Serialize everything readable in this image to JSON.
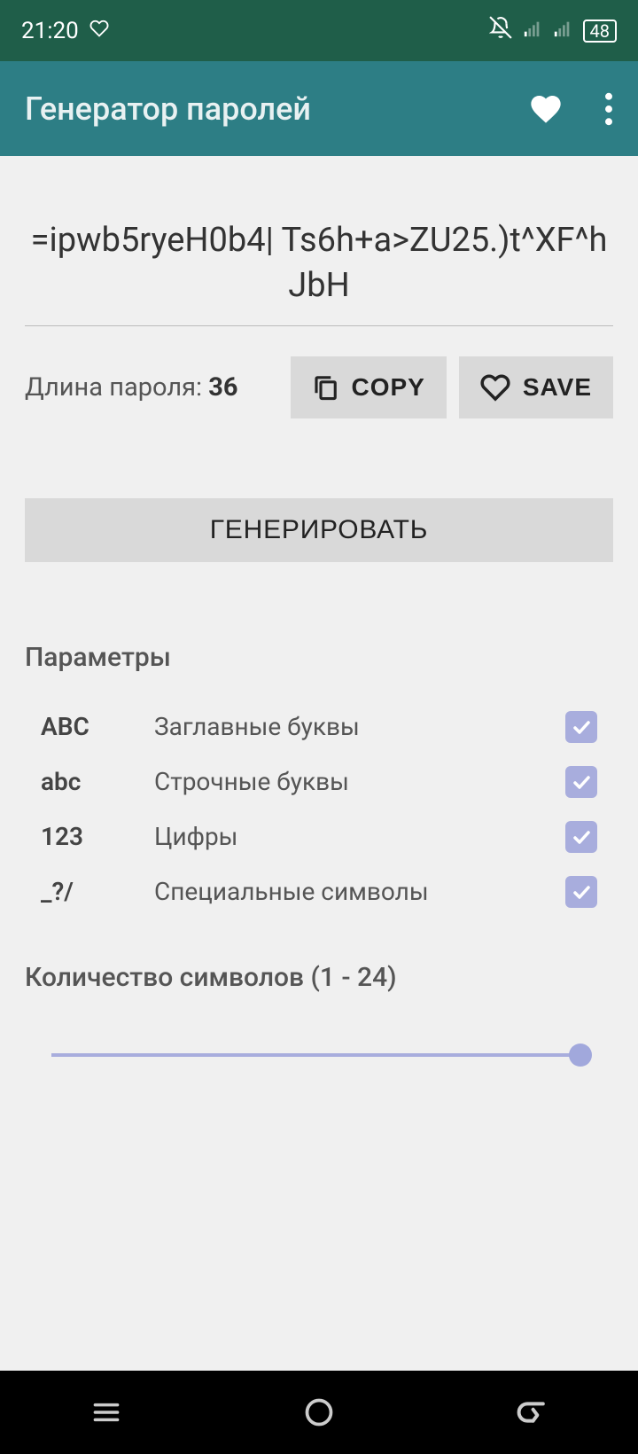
{
  "status": {
    "time": "21:20",
    "battery": "48"
  },
  "appbar": {
    "title": "Генератор паролей"
  },
  "main": {
    "password": "=ipwb5ryeH0b4| Ts6h+a>ZU25.)t^XF^hJbH",
    "length_label": "Длина пароля: ",
    "length_value": "36",
    "copy_label": "COPY",
    "save_label": "SAVE",
    "generate_label": "ГЕНЕРИРОВАТЬ",
    "params_title": "Параметры",
    "params": [
      {
        "short": "ABC",
        "label": "Заглавные буквы",
        "checked": true
      },
      {
        "short": "abc",
        "label": "Строчные буквы",
        "checked": true
      },
      {
        "short": "123",
        "label": "Цифры",
        "checked": true
      },
      {
        "short": "_?/",
        "label": "Специальные символы",
        "checked": true
      }
    ],
    "slider_title": "Количество символов (1 - 24)",
    "slider_value": 24,
    "slider_min": 1,
    "slider_max": 24
  }
}
